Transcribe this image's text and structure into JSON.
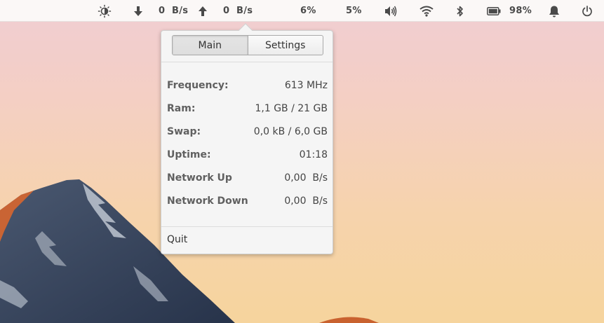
{
  "panel": {
    "net_down": "0  B/s",
    "net_up": "0  B/s",
    "cpu_percent": "6%",
    "mem_percent": "5%",
    "battery_percent": "98%"
  },
  "popover": {
    "tabs": [
      {
        "label": "Main",
        "active": true
      },
      {
        "label": "Settings",
        "active": false
      }
    ],
    "rows": [
      {
        "key": "Frequency:",
        "value": "613 MHz"
      },
      {
        "key": "Ram:",
        "value": "1,1 GB / 21 GB"
      },
      {
        "key": "Swap:",
        "value": "0,0 kB / 6,0 GB"
      },
      {
        "key": "Uptime:",
        "value": "01:18"
      },
      {
        "key": "Network Up",
        "value": "0,00  B/s"
      },
      {
        "key": "Network Down",
        "value": "0,00  B/s"
      }
    ],
    "quit_label": "Quit"
  }
}
